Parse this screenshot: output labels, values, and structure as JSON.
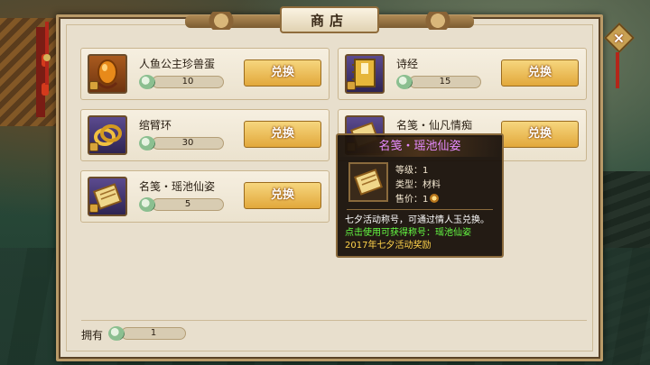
{
  "shop": {
    "title": "商店",
    "close_icon": "×",
    "exchange_label": "兑换",
    "items": [
      {
        "name": "人鱼公主珍兽蛋",
        "cost": "10",
        "icon": "egg-icon"
      },
      {
        "name": "诗经",
        "cost": "15",
        "icon": "book-icon"
      },
      {
        "name": "绾臂环",
        "cost": "30",
        "icon": "bracelet-icon"
      },
      {
        "name": "名笺・仙凡情痴",
        "cost": "",
        "icon": "scroll-icon"
      },
      {
        "name": "名笺・瑶池仙姿",
        "cost": "5",
        "icon": "scroll-icon"
      }
    ],
    "owned_label": "拥有",
    "owned_value": "1"
  },
  "tooltip": {
    "title": "名笺・瑶池仙姿",
    "level": "等级：1",
    "type": "类型：材料",
    "price": "售价：1",
    "desc_line1": "七夕活动称号，可通过情人玉兑换。",
    "desc_line2": "点击使用可获得称号：瑶池仙姿",
    "desc_line3": "2017年七夕活动奖励"
  },
  "colors": {
    "panel": "#e8dfcd",
    "button": "#e2a83b",
    "tooltip_title": "#e68bff",
    "desc_green": "#66ff44",
    "desc_gold": "#ffd34a"
  }
}
